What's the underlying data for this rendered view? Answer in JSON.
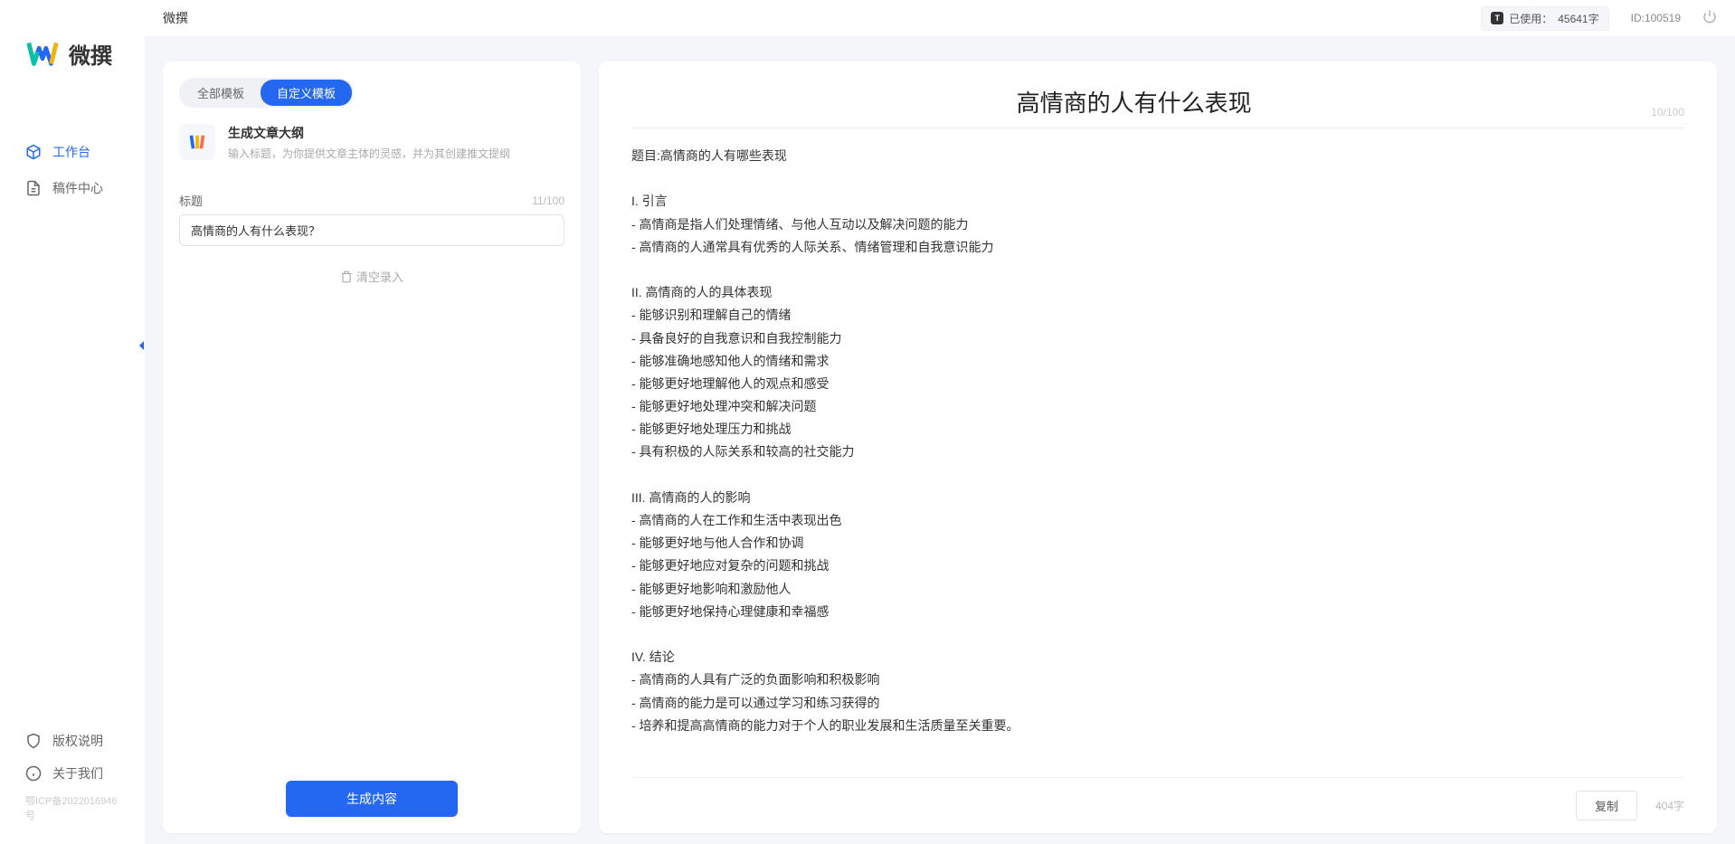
{
  "app": {
    "name": "微撰",
    "logo_text": "微撰"
  },
  "sidebar": {
    "nav": [
      {
        "label": "工作台",
        "icon": "cube-icon",
        "active": true
      },
      {
        "label": "稿件中心",
        "icon": "document-icon",
        "active": false
      }
    ],
    "bottom": [
      {
        "label": "版权说明",
        "icon": "shield-icon"
      },
      {
        "label": "关于我们",
        "icon": "info-icon"
      }
    ],
    "icp": "鄂ICP备2022016946号"
  },
  "topbar": {
    "title": "微撰",
    "usage_label": "已使用：",
    "usage_value": "45641字",
    "user_id_label": "ID:100519"
  },
  "left_panel": {
    "tabs": [
      {
        "label": "全部模板",
        "active": false
      },
      {
        "label": "自定义模板",
        "active": true
      }
    ],
    "template": {
      "title": "生成文章大纲",
      "desc": "输入标题，为你提供文章主体的灵感，并为其创建推文提纲"
    },
    "form": {
      "title_label": "标题",
      "title_counter": "11/100",
      "title_value": "高情商的人有什么表现？",
      "clear_label": "清空录入"
    },
    "generate_label": "生成内容"
  },
  "right_panel": {
    "doc_title": "高情商的人有什么表现",
    "doc_title_counter": "10/100",
    "doc_body": "题目:高情商的人有哪些表现\n\nI. 引言\n- 高情商是指人们处理情绪、与他人互动以及解决问题的能力\n- 高情商的人通常具有优秀的人际关系、情绪管理和自我意识能力\n\nII. 高情商的人的具体表现\n- 能够识别和理解自己的情绪\n- 具备良好的自我意识和自我控制能力\n- 能够准确地感知他人的情绪和需求\n- 能够更好地理解他人的观点和感受\n- 能够更好地处理冲突和解决问题\n- 能够更好地处理压力和挑战\n- 具有积极的人际关系和较高的社交能力\n\nIII. 高情商的人的影响\n- 高情商的人在工作和生活中表现出色\n- 能够更好地与他人合作和协调\n- 能够更好地应对复杂的问题和挑战\n- 能够更好地影响和激励他人\n- 能够更好地保持心理健康和幸福感\n\nIV. 结论\n- 高情商的人具有广泛的负面影响和积极影响\n- 高情商的能力是可以通过学习和练习获得的\n- 培养和提高高情商的能力对于个人的职业发展和生活质量至关重要。",
    "copy_label": "复制",
    "word_count": "404字"
  }
}
